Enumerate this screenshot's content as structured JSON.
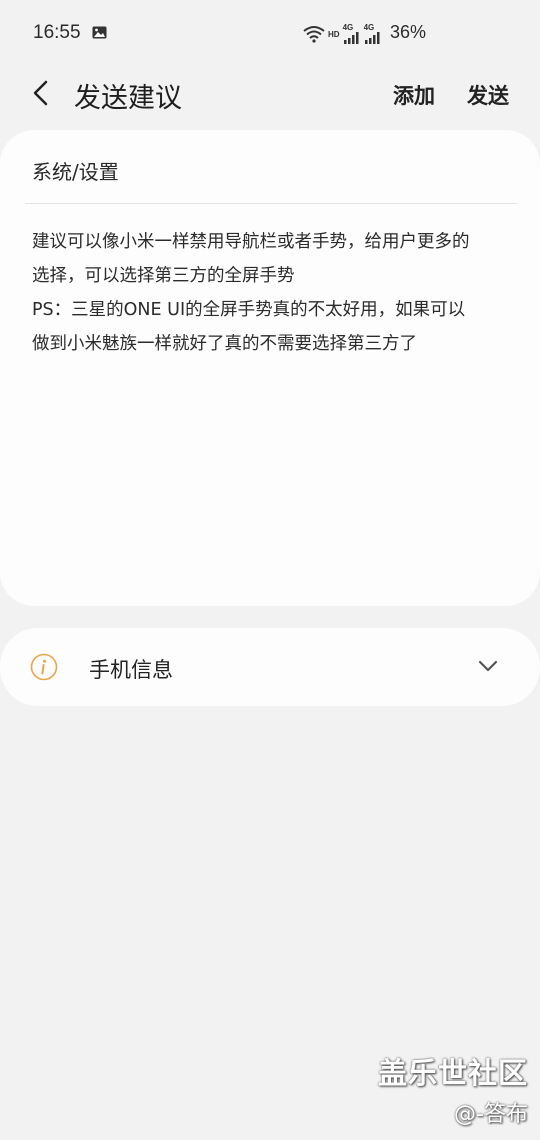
{
  "status_bar": {
    "time": "16:55",
    "battery": "36%",
    "hd_tag": "HD",
    "net_tag1": "4G",
    "net_tag2": "4G",
    "icons": [
      "image-icon",
      "wifi-icon",
      "signal-icon",
      "signal-icon"
    ]
  },
  "header": {
    "title": "发送建议",
    "add_label": "添加",
    "send_label": "发送",
    "back_icon": "back-arrow-icon"
  },
  "feedback": {
    "category": "系统/设置",
    "lines": [
      "建议可以像小米一样禁用导航栏或者手势，给用户更多的",
      "选择，可以选择第三方的全屏手势",
      "PS：三星的ONE  UI的全屏手势真的不太好用，如果可以",
      "做到小米魅族一样就好了真的不需要选择第三方了"
    ]
  },
  "phone_info": {
    "label": "手机信息",
    "icon": "info-icon",
    "accent_color": "#e8a64a"
  },
  "watermark": {
    "line1": "盖乐世社区",
    "line2": "@-答布"
  }
}
